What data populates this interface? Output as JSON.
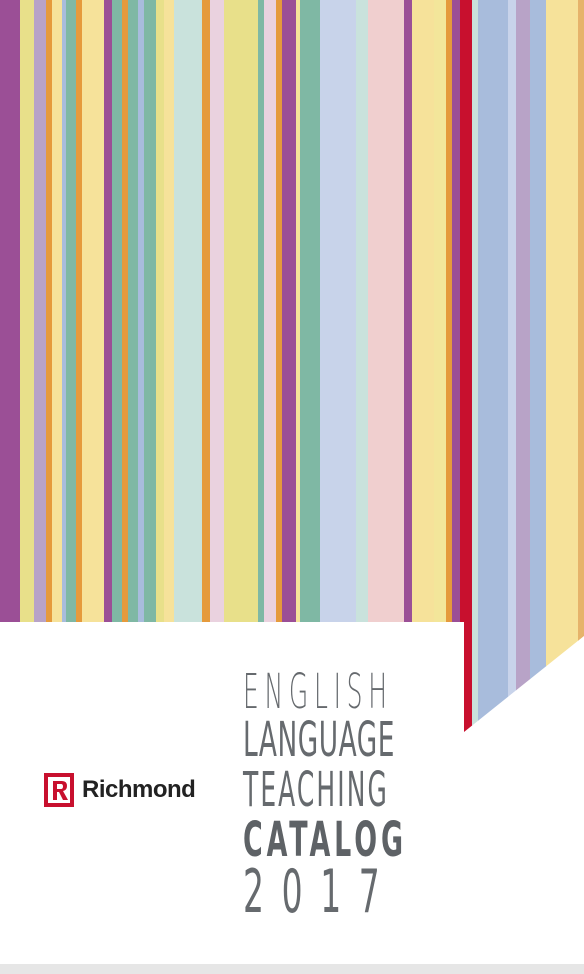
{
  "brand": {
    "name": "Richmond"
  },
  "title": {
    "line1": "ENGLISH",
    "line2": "LANGUAGE",
    "line3": "TEACHING",
    "line4": "CATALOG",
    "line5": "2017"
  },
  "colors": {
    "brand": "#c8102e",
    "title_text": "#666a6e",
    "stripes": [
      "#9b4f96",
      "#e8e08a",
      "#b8a3c7",
      "#e59a3c",
      "#f6e29a",
      "#a8bcdc",
      "#7fb8a4",
      "#c9e2dc",
      "#ead2df",
      "#c8d3ea",
      "#f0cfcf",
      "#f3e69a",
      "#c8102e",
      "#e6b36a"
    ]
  }
}
